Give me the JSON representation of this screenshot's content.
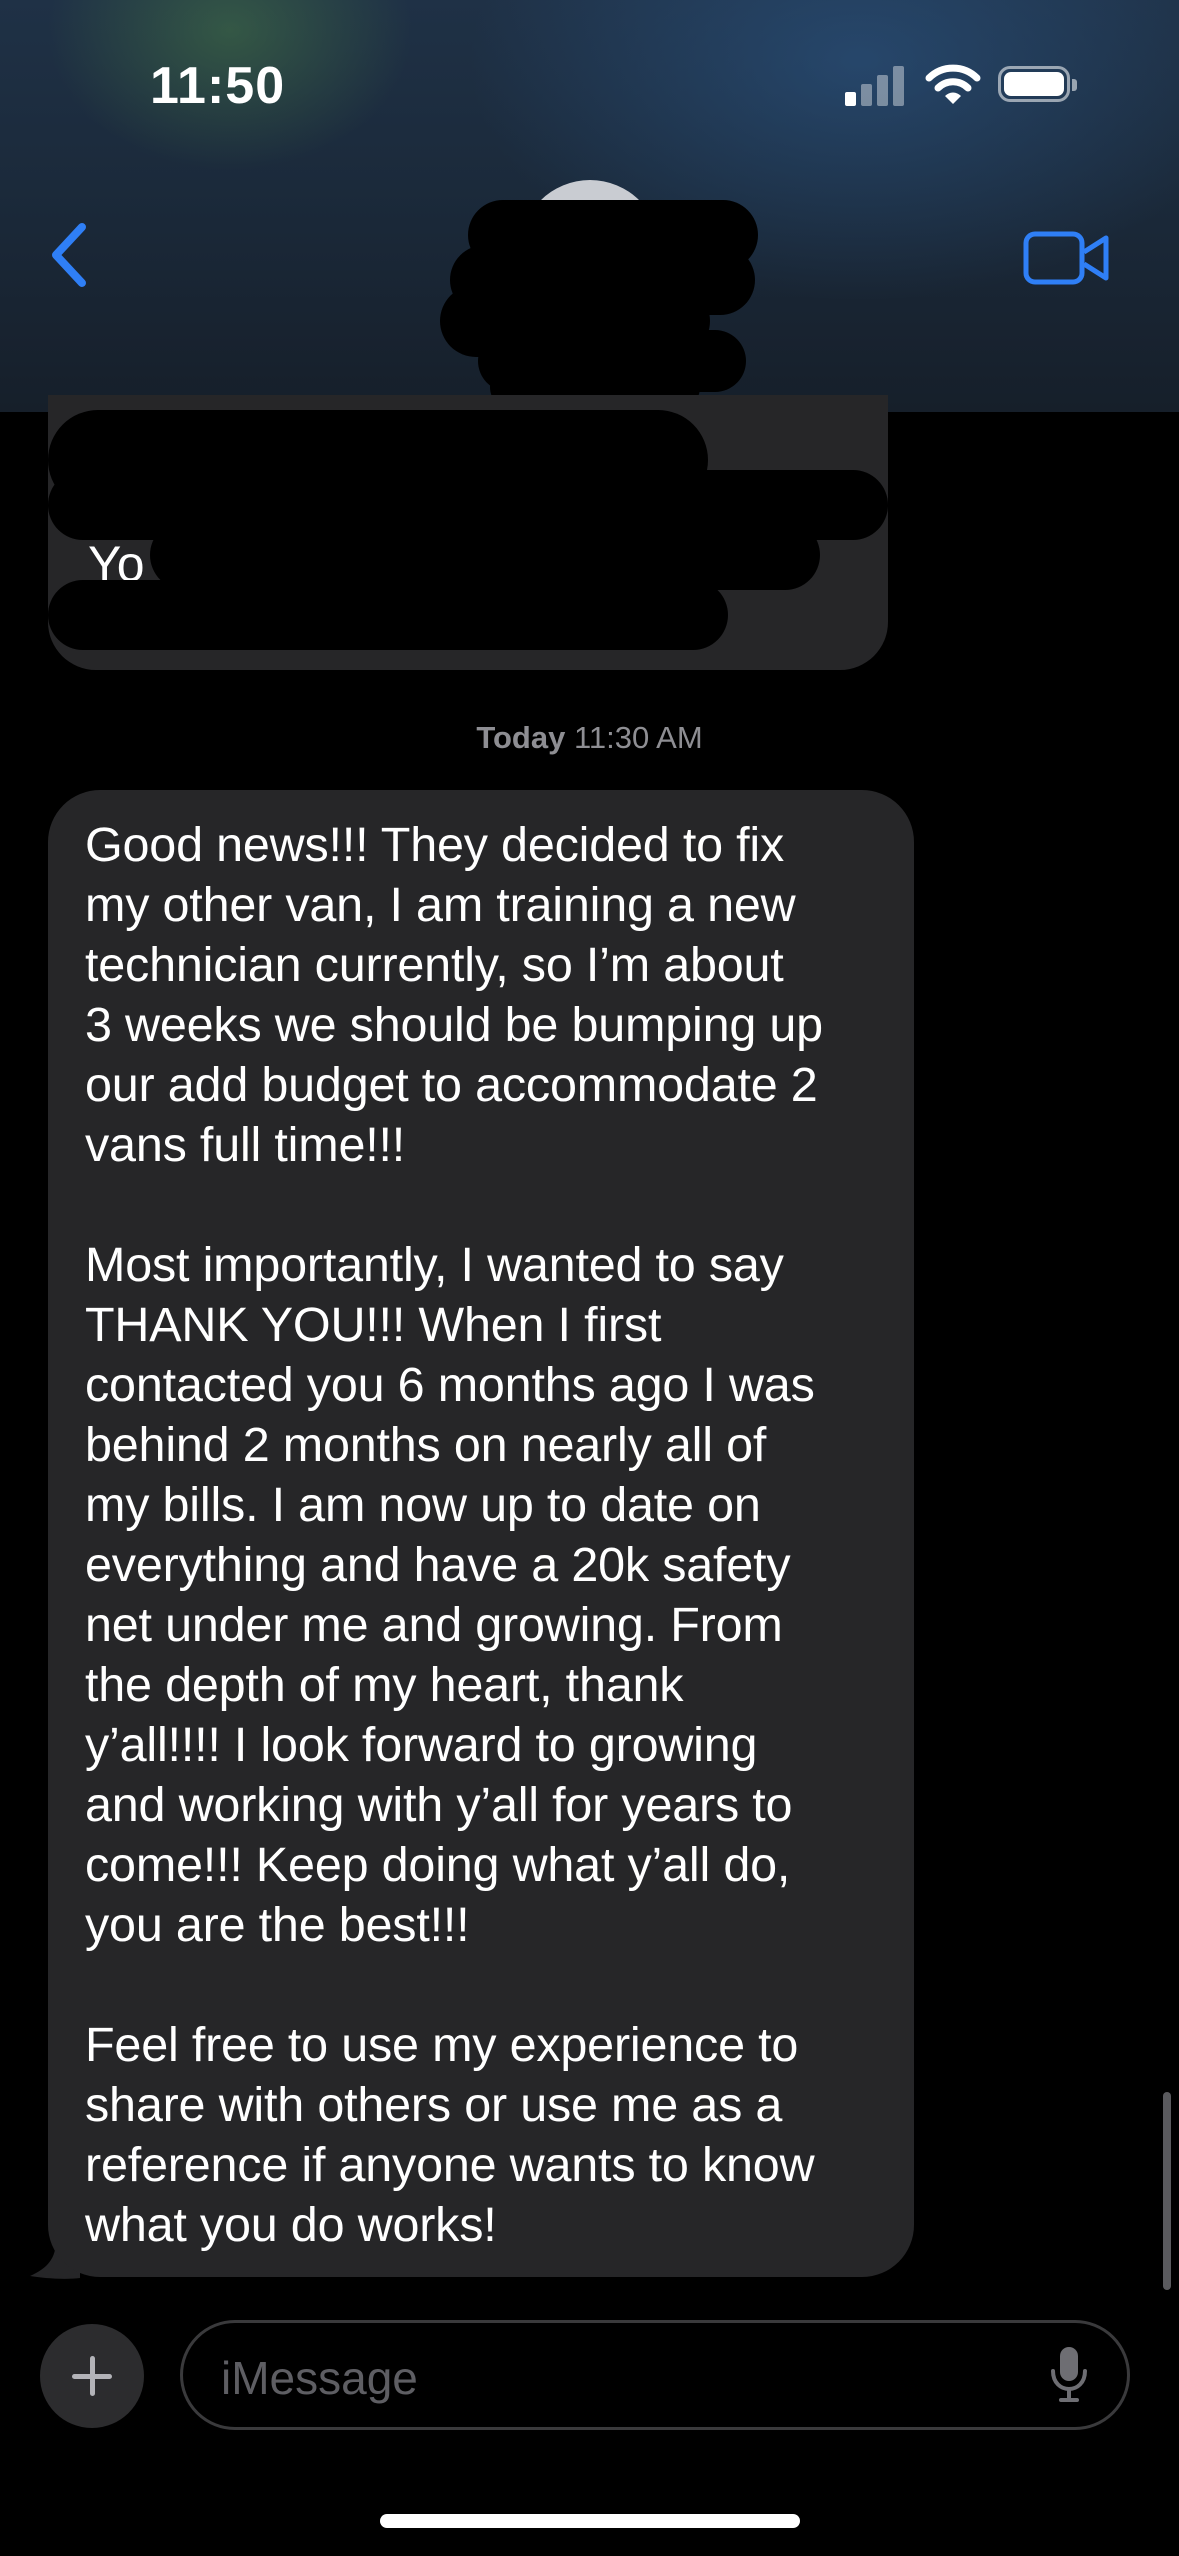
{
  "status_bar": {
    "time": "11:50"
  },
  "header": {
    "back_icon": "chevron-left-icon",
    "video_icon": "video-camera-icon"
  },
  "previous_message": {
    "fragment": "Yo"
  },
  "timestamp": {
    "day": "Today",
    "time": "11:30 AM"
  },
  "message": {
    "paragraphs": [
      "Good news!!! They decided to fix\nmy other van, I am training a new\ntechnician currently, so I’m about\n3 weeks we should be bumping up\nour add budget to accommodate 2\nvans full time!!!",
      "Most importantly, I wanted to say\nTHANK YOU!!! When I first\ncontacted you 6 months ago I was\nbehind 2 months on nearly all of\nmy bills. I am now up to date on\neverything and have a 20k safety\nnet under me and growing. From\nthe depth of my heart, thank\ny’all!!!! I look forward to growing\nand working with y’all for years to\ncome!!! Keep doing what y’all do,\nyou are the best!!!",
      "Feel free to use my experience to\nshare with others or use me as a\nreference if anyone wants to know\nwhat you do works!"
    ]
  },
  "compose": {
    "placeholder": "iMessage",
    "plus_icon": "plus-icon",
    "mic_icon": "microphone-icon"
  },
  "colors": {
    "accent": "#2f7ff6",
    "bubble": "#262628",
    "background": "#000000"
  }
}
